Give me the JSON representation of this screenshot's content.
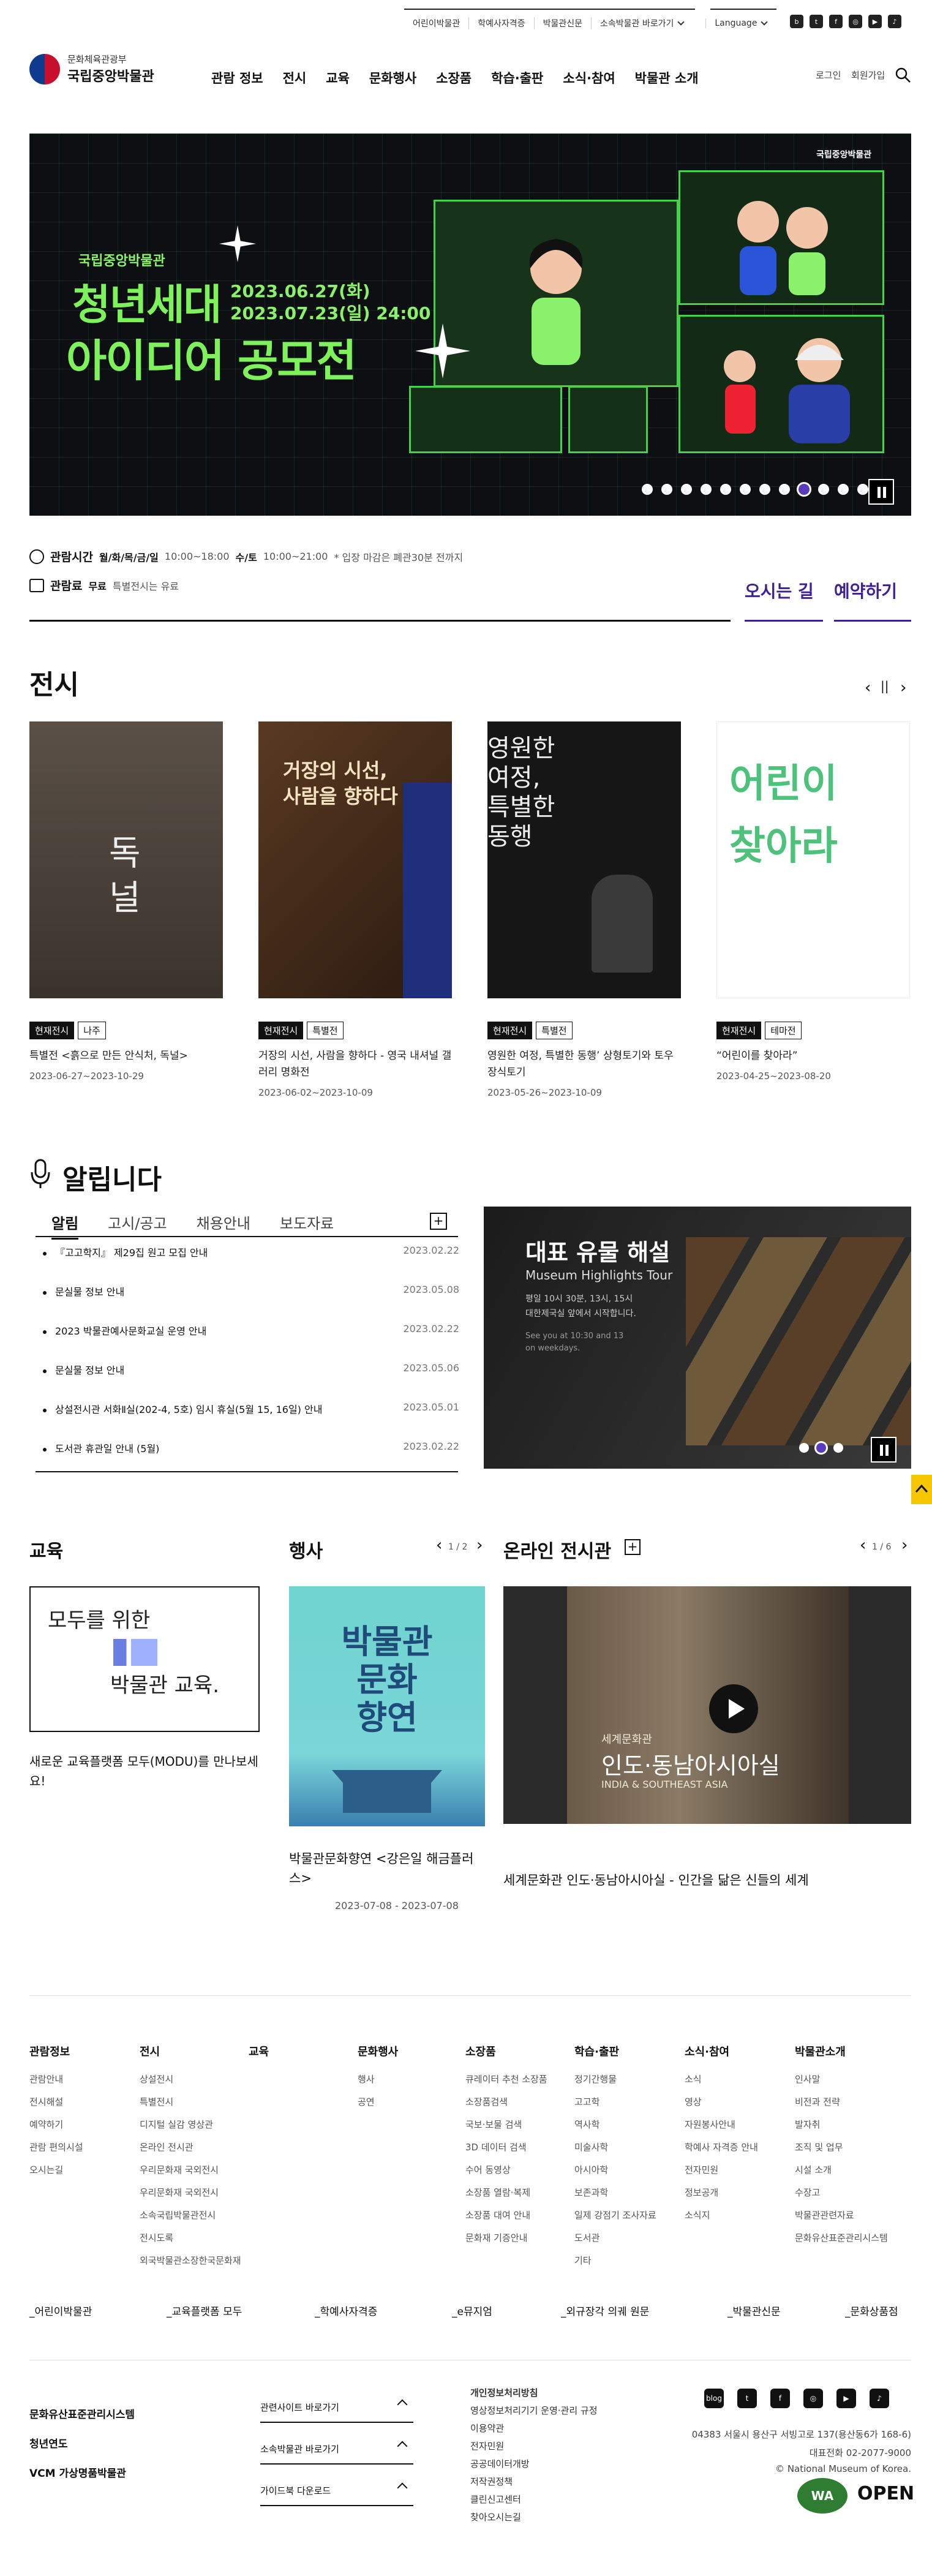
{
  "util": {
    "links": [
      "어린이박물관",
      "학예사자격증",
      "박물관신문",
      "소속박물관 바로가기"
    ],
    "language": "Language",
    "sns": [
      "blog-icon",
      "twitter-icon",
      "facebook-icon",
      "instagram-icon",
      "youtube-icon",
      "podcast-icon"
    ]
  },
  "logo": {
    "org": "문화체육관광부",
    "name": "국립중앙박물관"
  },
  "gnb": [
    "관람 정보",
    "전시",
    "교육",
    "문화행사",
    "소장품",
    "학습·출판",
    "소식·참여",
    "박물관 소개"
  ],
  "auth": {
    "login": "로그인",
    "join": "회원가입"
  },
  "banner": {
    "org": "국립중앙박물관",
    "date1": "2023.06.27(화)",
    "date2": "2023.07.23(일) 24:00",
    "title1": "청년세대",
    "title2": "아이디어 공모전",
    "logo": "국립중앙박물관",
    "slides": 12,
    "active_slide": 9
  },
  "hours": {
    "label": "관람시간",
    "days1": "월/화/목/금/일",
    "time1": "10:00~18:00",
    "days2": "수/토",
    "time2": "10:00~21:00",
    "note": "* 입장 마감은 폐관30분 전까지"
  },
  "fee": {
    "label": "관람료",
    "free": "무료",
    "note": "특별전시는 유료"
  },
  "cta": {
    "way": "오시는 길",
    "reserve": "예약하기"
  },
  "exhibitions": {
    "title": "전시",
    "items": [
      {
        "tags": [
          "현재전시",
          "나주"
        ],
        "title": "특별전 <흙으로 만든 안식처, 독널>",
        "date": "2023-06-27~2023-10-29",
        "art": "독\n널",
        "bg": "#4a4138"
      },
      {
        "tags": [
          "현재전시",
          "특별전"
        ],
        "title": "거장의 시선, 사람을 향하다 - 영국 내셔널 갤러리 명화전",
        "date": "2023-06-02~2023-10-09",
        "art": "거장의 시선,\n사람을 향하다",
        "bg": "#3c2c1e"
      },
      {
        "tags": [
          "현재전시",
          "특별전"
        ],
        "title": "영원한 여정, 특별한 동행’ 상형토기와 토우 장식토기",
        "date": "2023-05-26~2023-10-09",
        "art": "영원한\n여정,\n특별한\n동행",
        "bg": "#141414"
      },
      {
        "tags": [
          "현재전시",
          "테마전"
        ],
        "title": "“어린이를 찾아라”",
        "date": "2023-04-25~2023-08-20",
        "art": "어린이\n찾아라",
        "bg": "#ffffff"
      }
    ]
  },
  "notices": {
    "title": "알립니다",
    "tabs": [
      "알림",
      "고시/공고",
      "채용안내",
      "보도자료"
    ],
    "items": [
      {
        "title": "『고고학지』 제29집 원고 모집 안내",
        "date": "2023.02.22"
      },
      {
        "title": "문실물 정보 안내",
        "date": "2023.05.08"
      },
      {
        "title": "2023 박물관예사문화교실 운영 안내",
        "date": "2023.02.22"
      },
      {
        "title": "문실물 정보 안내",
        "date": "2023.05.06"
      },
      {
        "title": "상설전시관 서화Ⅱ실(202-4, 5호) 임시 휴실(5월 15, 16일) 안내",
        "date": "2023.05.01"
      },
      {
        "title": "도서관 휴관일 안내 (5월)",
        "date": "2023.02.22"
      }
    ]
  },
  "highlight": {
    "title": "대표 유물 해설",
    "subtitle": "Museum Highlights Tour",
    "desc1": "평일 10시 30분, 13시, 15시",
    "desc2": "대한제국실 앞에서 시작합니다.",
    "desc3": "See you at 10:30 and 13",
    "desc4": "on weekdays."
  },
  "education": {
    "title": "교육",
    "line1": "모두를 위한",
    "line2": "박물관 교육.",
    "caption": "새로운 교육플랫폼 모두(MODU)를 만나보세요!"
  },
  "event": {
    "title": "행사",
    "pager": "1 / 2",
    "art": "박물관\n문화\n향연",
    "name": "박물관문화향연 <강은일 해금플러스>",
    "date": "2023-07-08 - 2023-07-08"
  },
  "online": {
    "title": "온라인 전시관",
    "pager": "1 / 6",
    "art_sub": "세계문화관",
    "art_main": "인도·동남아시아실",
    "art_en": "INDIA & SOUTHEAST ASIA",
    "name": "세계문화관 인도·동남아시아실 - 인간을 닮은 신들의 세계"
  },
  "footer_nav": [
    {
      "head": "관람정보",
      "items": [
        "관람안내",
        "전시해설",
        "예약하기",
        "관람 편의시설",
        "오시는길"
      ]
    },
    {
      "head": "전시",
      "items": [
        "상설전시",
        "특별전시",
        "디지털 실감 영상관",
        "온라인 전시관",
        "우리문화재 국외전시",
        "우리문화재 국외전시",
        "소속국립박물관전시",
        "전시도록",
        "외국박물관소장한국문화재"
      ]
    },
    {
      "head": "교육",
      "items": []
    },
    {
      "head": "문화행사",
      "items": [
        "행사",
        "공연"
      ]
    },
    {
      "head": "소장품",
      "items": [
        "큐레이터 추천 소장품",
        "소장품검색",
        "국보·보물 검색",
        "3D 데이터 검색",
        "수어 동영상",
        "소장품 열람·복제",
        "소장품 대여 안내",
        "문화재 기증안내"
      ]
    },
    {
      "head": "학습·출판",
      "items": [
        "정기간행물",
        "고고학",
        "역사학",
        "미술사학",
        "아시아학",
        "보존과학",
        "일제 강점기 조사자료",
        "도서관",
        "기타"
      ]
    },
    {
      "head": "소식·참여",
      "items": [
        "소식",
        "영상",
        "자원봉사안내",
        "학예사 자격증 안내",
        "전자민원",
        "정보공개",
        "소식지"
      ]
    },
    {
      "head": "박물관소개",
      "items": [
        "인사말",
        "비전과 전략",
        "발자취",
        "조직 및 업무",
        "시설 소개",
        "수장고",
        "박물관관련자료",
        "문화유산표준관리시스템"
      ]
    }
  ],
  "footer_links": [
    "_어린이박물관",
    "_교육플랫폼 모두",
    "_학예사자격증",
    "_e뮤지엄",
    "_외규장각 의궤 원문",
    "_박물관신문",
    "_문화상품점"
  ],
  "footer_left": [
    "문화유산표준관리시스템",
    "청년연도",
    "VCM 가상명품박물관"
  ],
  "footer_selects": [
    "관련사이트 바로가기",
    "소속박물관 바로가기",
    "가이드북 다운로드"
  ],
  "policies": [
    "개인정보처리방침",
    "영상정보처리기기 운영·관리 규정",
    "이용약관",
    "전자민원",
    "공공데이터개방",
    "저작권정책",
    "클린신고센터",
    "찾아오시는길"
  ],
  "address": "04383 서울시 용산구 서빙고로 137(용산동6가 168-6)",
  "tel": "대표전화 02-2077-9000",
  "copyright": "© National Museum of Korea.",
  "badges": {
    "wa": "WA",
    "open": "OPEN"
  }
}
